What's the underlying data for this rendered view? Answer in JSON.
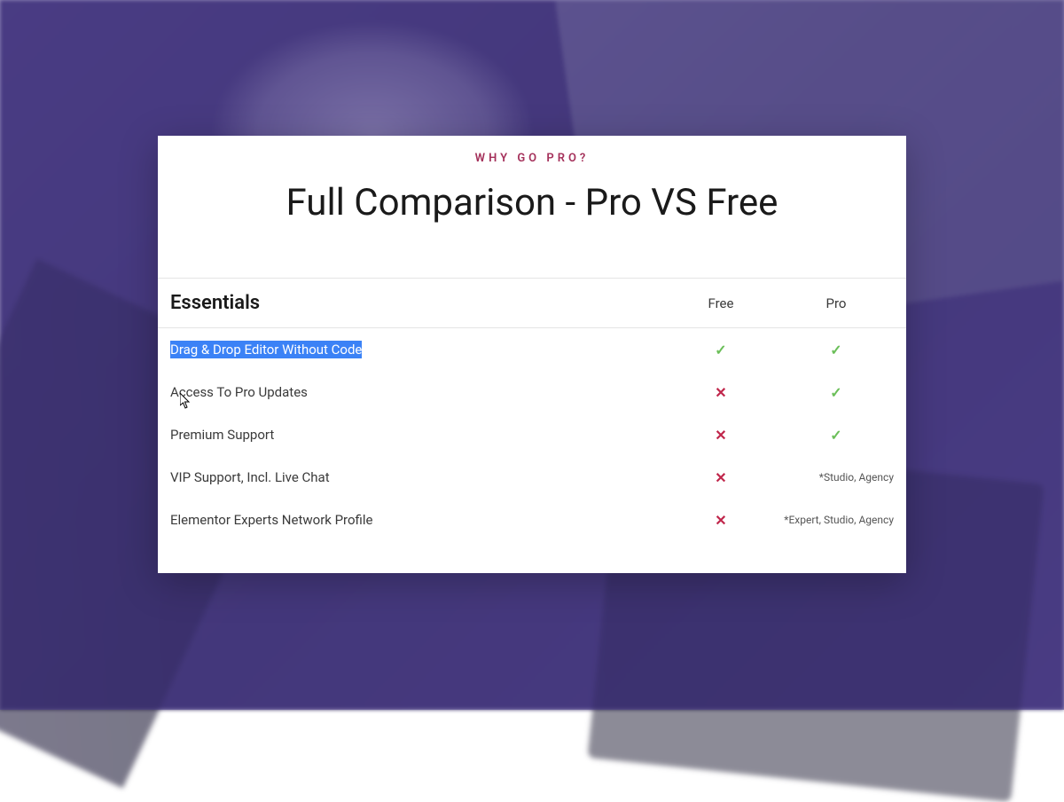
{
  "header": {
    "eyebrow": "WHY GO PRO?",
    "title": "Full Comparison - Pro VS Free"
  },
  "columns": {
    "section": "Essentials",
    "free": "Free",
    "pro": "Pro"
  },
  "rows": [
    {
      "label": "Drag & Drop Editor Without Code",
      "highlighted": true,
      "free": "check",
      "pro": "check"
    },
    {
      "label": "Access To Pro Updates",
      "highlighted": false,
      "free": "cross",
      "pro": "check"
    },
    {
      "label": "Premium Support",
      "highlighted": false,
      "free": "cross",
      "pro": "check"
    },
    {
      "label": "VIP Support, Incl. Live Chat",
      "highlighted": false,
      "free": "cross",
      "pro_note": "*Studio, Agency"
    },
    {
      "label": "Elementor Experts Network Profile",
      "highlighted": false,
      "free": "cross",
      "pro_note": "*Expert, Studio, Agency"
    }
  ],
  "icons": {
    "check": "✓",
    "cross": "✕"
  }
}
